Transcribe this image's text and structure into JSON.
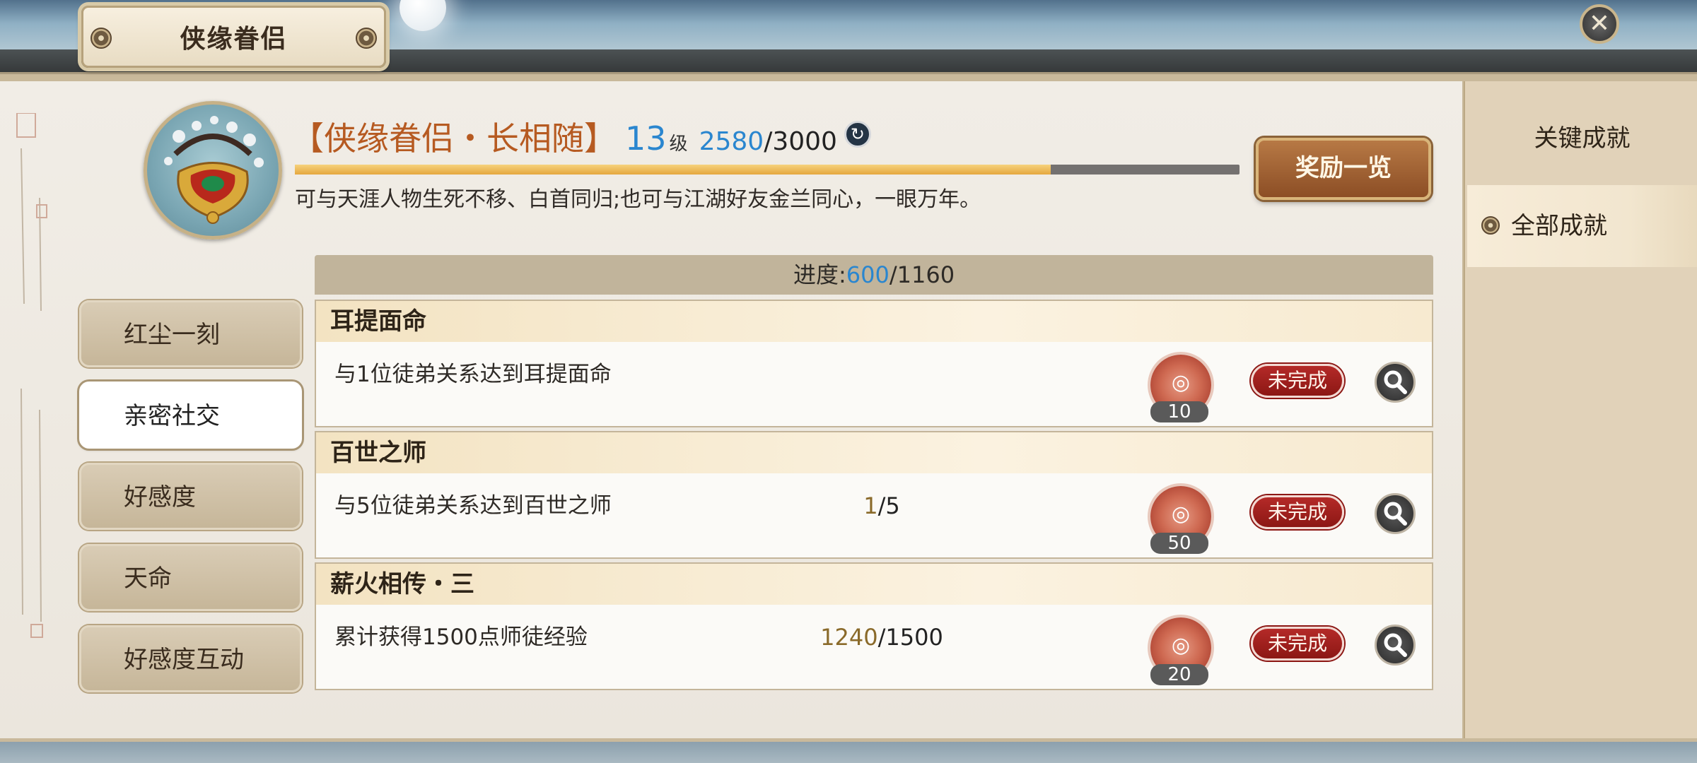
{
  "window": {
    "title": "侠缘眷侣"
  },
  "header": {
    "name": "【侠缘眷侣・长相随】",
    "level": "13",
    "level_unit": "级",
    "exp_current": "2580",
    "exp_separator": "/",
    "exp_max": "3000",
    "exp_fraction": 0.8,
    "description": "可与天涯人物生死不移、白首同归;也可与江湖好友金兰同心，一眼万年。",
    "reward_button": "奖励一览"
  },
  "right_nav": {
    "items": [
      {
        "label": "关键成就"
      },
      {
        "label": "全部成就"
      }
    ]
  },
  "left_tabs": [
    {
      "label": "红尘一刻"
    },
    {
      "label": "亲密社交"
    },
    {
      "label": "好感度"
    },
    {
      "label": "天命"
    },
    {
      "label": "好感度互动"
    }
  ],
  "progress": {
    "label": "进度:",
    "current": "600",
    "separator": "/",
    "total": "1160"
  },
  "achievements": [
    {
      "title": "耳提面命",
      "desc": "与1位徒弟关系达到耳提面命",
      "count_cur": "",
      "count_sep": "",
      "count_max": "",
      "reward": "10",
      "status": "未完成"
    },
    {
      "title": "百世之师",
      "desc": "与5位徒弟关系达到百世之师",
      "count_cur": "1",
      "count_sep": "/",
      "count_max": "5",
      "reward": "50",
      "status": "未完成"
    },
    {
      "title": "薪火相传・三",
      "desc": "累计获得1500点师徒经验",
      "count_cur": "1240",
      "count_sep": "/",
      "count_max": "1500",
      "reward": "20",
      "status": "未完成"
    }
  ],
  "icons": {
    "close": "close-icon",
    "refresh": "refresh-icon",
    "search": "search-icon",
    "medal": "medal-icon",
    "knot": "knot-icon"
  },
  "colors": {
    "accent_blue": "#2a86cf",
    "title_orange": "#b65a21",
    "status_red": "#a0201d",
    "xp_fill": "#f0bf5a"
  }
}
